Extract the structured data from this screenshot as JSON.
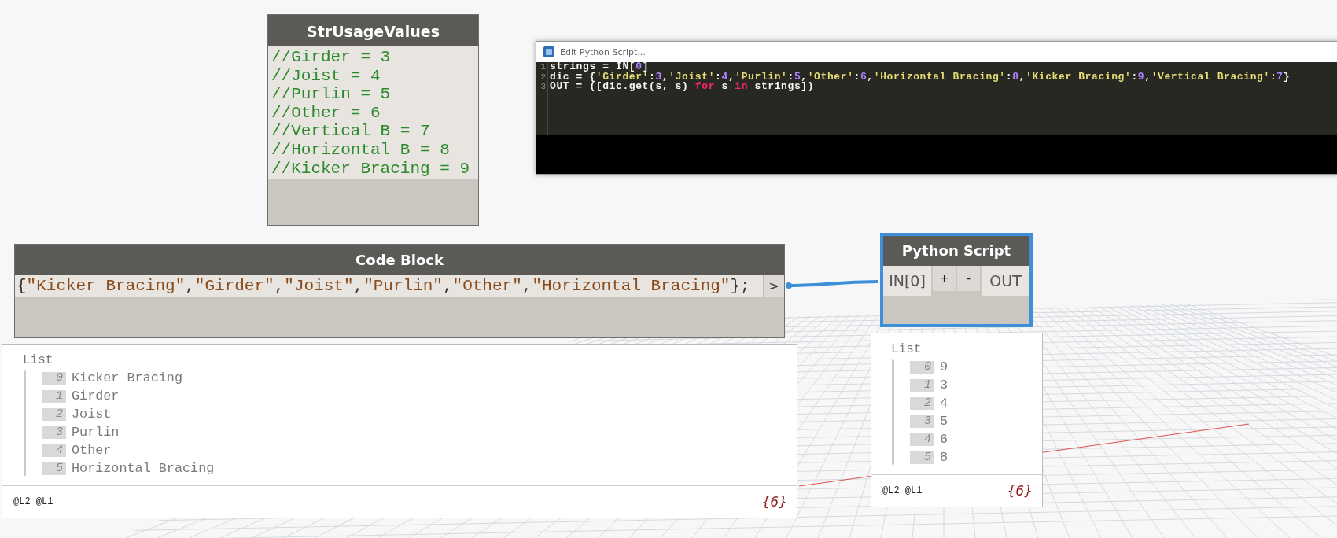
{
  "str_usage_node": {
    "title": "StrUsageValues",
    "lines": [
      "//Girder = 3",
      "//Joist = 4",
      "//Purlin = 5",
      "//Other = 6",
      "//Vertical B = 7",
      "//Horizontal B = 8",
      "//Kicker Bracing = 9"
    ]
  },
  "editor": {
    "title": "Edit Python Script...",
    "lines": [
      {
        "number": "1",
        "tokens": [
          {
            "kind": "plain",
            "text": "strings = IN["
          },
          {
            "kind": "number",
            "text": "0"
          },
          {
            "kind": "plain",
            "text": "]"
          }
        ]
      },
      {
        "number": "2",
        "tokens": [
          {
            "kind": "plain",
            "text": "dic = {"
          },
          {
            "kind": "string",
            "text": "'Girder'"
          },
          {
            "kind": "plain",
            "text": ":"
          },
          {
            "kind": "number",
            "text": "3"
          },
          {
            "kind": "plain",
            "text": ","
          },
          {
            "kind": "string",
            "text": "'Joist'"
          },
          {
            "kind": "plain",
            "text": ":"
          },
          {
            "kind": "number",
            "text": "4"
          },
          {
            "kind": "plain",
            "text": ","
          },
          {
            "kind": "string",
            "text": "'Purlin'"
          },
          {
            "kind": "plain",
            "text": ":"
          },
          {
            "kind": "number",
            "text": "5"
          },
          {
            "kind": "plain",
            "text": ","
          },
          {
            "kind": "string",
            "text": "'Other'"
          },
          {
            "kind": "plain",
            "text": ":"
          },
          {
            "kind": "number",
            "text": "6"
          },
          {
            "kind": "plain",
            "text": ","
          },
          {
            "kind": "string",
            "text": "'Horizontal Bracing'"
          },
          {
            "kind": "plain",
            "text": ":"
          },
          {
            "kind": "number",
            "text": "8"
          },
          {
            "kind": "plain",
            "text": ","
          },
          {
            "kind": "string",
            "text": "'Kicker Bracing'"
          },
          {
            "kind": "plain",
            "text": ":"
          },
          {
            "kind": "number",
            "text": "9"
          },
          {
            "kind": "plain",
            "text": ","
          },
          {
            "kind": "string",
            "text": "'Vertical Bracing'"
          },
          {
            "kind": "plain",
            "text": ":"
          },
          {
            "kind": "number",
            "text": "7"
          },
          {
            "kind": "plain",
            "text": "}"
          }
        ]
      },
      {
        "number": "3",
        "tokens": [
          {
            "kind": "plain",
            "text": "OUT = ([dic.get(s, s) "
          },
          {
            "kind": "keyword",
            "text": "for"
          },
          {
            "kind": "plain",
            "text": " s "
          },
          {
            "kind": "keyword",
            "text": "in"
          },
          {
            "kind": "plain",
            "text": " strings])"
          }
        ]
      }
    ]
  },
  "code_block_node": {
    "title": "Code Block",
    "tokens": [
      {
        "kind": "plain",
        "text": "{"
      },
      {
        "kind": "string",
        "text": "\"Kicker Bracing\""
      },
      {
        "kind": "plain",
        "text": ","
      },
      {
        "kind": "string",
        "text": "\"Girder\""
      },
      {
        "kind": "plain",
        "text": ","
      },
      {
        "kind": "string",
        "text": "\"Joist\""
      },
      {
        "kind": "plain",
        "text": ","
      },
      {
        "kind": "string",
        "text": "\"Purlin\""
      },
      {
        "kind": "plain",
        "text": ","
      },
      {
        "kind": "string",
        "text": "\"Other\""
      },
      {
        "kind": "plain",
        "text": ","
      },
      {
        "kind": "string",
        "text": "\"Horizontal Bracing\""
      },
      {
        "kind": "plain",
        "text": "};"
      }
    ],
    "output_port": ">"
  },
  "code_block_preview": {
    "heading": "List",
    "items": [
      {
        "index": "0",
        "value": "Kicker Bracing"
      },
      {
        "index": "1",
        "value": "Girder"
      },
      {
        "index": "2",
        "value": "Joist"
      },
      {
        "index": "3",
        "value": "Purlin"
      },
      {
        "index": "4",
        "value": "Other"
      },
      {
        "index": "5",
        "value": "Horizontal Bracing"
      }
    ],
    "levels": "@L2 @L1",
    "count": "{6}"
  },
  "python_node": {
    "title": "Python Script",
    "selected": true,
    "ports": [
      {
        "kind": "input",
        "label": "IN[0]"
      },
      {
        "kind": "add",
        "label": "+"
      },
      {
        "kind": "remove",
        "label": "-"
      },
      {
        "kind": "output",
        "label": "OUT"
      }
    ]
  },
  "python_preview": {
    "heading": "List",
    "items": [
      {
        "index": "0",
        "value": "9"
      },
      {
        "index": "1",
        "value": "3"
      },
      {
        "index": "2",
        "value": "4"
      },
      {
        "index": "3",
        "value": "5"
      },
      {
        "index": "4",
        "value": "6"
      },
      {
        "index": "5",
        "value": "8"
      }
    ],
    "levels": "@L2 @L1",
    "count": "{6}"
  }
}
